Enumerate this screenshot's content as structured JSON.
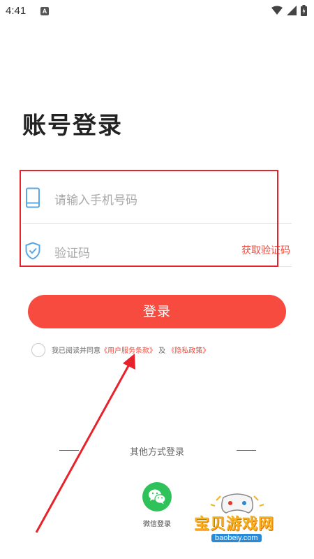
{
  "status_bar": {
    "time": "4:41",
    "notification_icon": "A",
    "icons": [
      "wifi-icon",
      "signal-icon",
      "battery-icon"
    ]
  },
  "page": {
    "title": "账号登录"
  },
  "form": {
    "phone": {
      "placeholder": "请输入手机号码",
      "icon": "phone-icon"
    },
    "code": {
      "placeholder": "验证码",
      "icon": "shield-check-icon",
      "action_label": "获取验证码"
    }
  },
  "login_button": {
    "label": "登录"
  },
  "agreement": {
    "prefix": "我已阅读并同意",
    "terms_link": "《用户服务条款》",
    "conjunction": "及",
    "privacy_link": "《隐私政策》"
  },
  "other_login": {
    "label": "其他方式登录",
    "wechat": {
      "label": "微信登录",
      "icon": "wechat-icon"
    }
  },
  "watermark": {
    "title": "宝贝游戏网",
    "url": "baobeiy.com"
  },
  "colors": {
    "accent": "#f84b40",
    "link": "#f24b3e",
    "annotation": "#e8222a",
    "wechat": "#30c25a",
    "icon_blue": "#5aa7e6"
  }
}
